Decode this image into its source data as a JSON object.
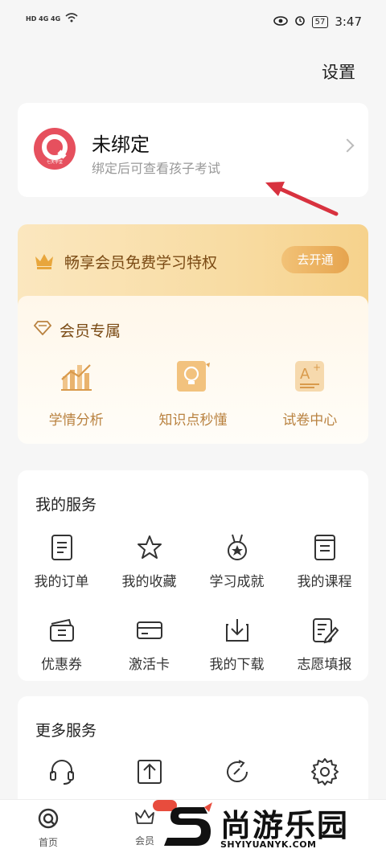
{
  "status_bar": {
    "left_text": "HD 4G 4G",
    "battery": "57",
    "time": "3:47"
  },
  "header": {
    "settings_label": "设置"
  },
  "bind_card": {
    "title": "未绑定",
    "subtitle": "绑定后可查看孩子考试",
    "logo_text": "七天学堂"
  },
  "vip_banner": {
    "title": "畅享会员免费学习特权",
    "button_label": "去开通"
  },
  "vip_section": {
    "title": "会员专属",
    "items": [
      {
        "label": "学情分析",
        "icon": "bar-chart-icon"
      },
      {
        "label": "知识点秒懂",
        "icon": "lightbulb-icon"
      },
      {
        "label": "试卷中心",
        "icon": "exam-paper-icon"
      }
    ]
  },
  "my_services": {
    "title": "我的服务",
    "items": [
      {
        "label": "我的订单",
        "icon": "order-icon"
      },
      {
        "label": "我的收藏",
        "icon": "star-icon"
      },
      {
        "label": "学习成就",
        "icon": "medal-icon"
      },
      {
        "label": "我的课程",
        "icon": "course-icon"
      },
      {
        "label": "优惠券",
        "icon": "coupon-icon"
      },
      {
        "label": "激活卡",
        "icon": "card-icon"
      },
      {
        "label": "我的下载",
        "icon": "download-icon"
      },
      {
        "label": "志愿填报",
        "icon": "edit-form-icon"
      }
    ]
  },
  "more_services": {
    "title": "更多服务",
    "items": [
      {
        "label": "",
        "icon": "headset-icon"
      },
      {
        "label": "",
        "icon": "upload-icon"
      },
      {
        "label": "",
        "icon": "refresh-icon"
      },
      {
        "label": "",
        "icon": "gear-icon"
      }
    ]
  },
  "tab_bar": {
    "items": [
      {
        "label": "首页",
        "icon": "home-logo-icon"
      },
      {
        "label": "会员",
        "icon": "crown-icon"
      }
    ]
  },
  "watermark": {
    "cn": "尚游乐园",
    "en": "SHYIYUANYK.COM"
  },
  "colors": {
    "accent_gold": "#b98240",
    "vip_text": "#7a4a14",
    "logo_red": "#e6505e",
    "arrow_red": "#d8323f"
  }
}
